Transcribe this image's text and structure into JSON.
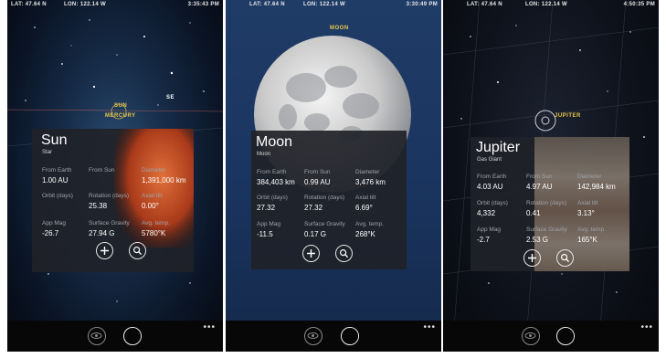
{
  "screens": [
    {
      "status": {
        "lat": "LAT: 47.64 N",
        "lon": "LON: 122.14 W",
        "time": "3:35:43 PM"
      },
      "sky_labels": {
        "sun": "SUN",
        "mercury": "MERCURY",
        "se": "SE"
      },
      "card": {
        "name": "Sun",
        "type": "Star",
        "from_earth_label": "From Earth",
        "from_earth": "1.00 AU",
        "from_sun_label": "From Sun",
        "from_sun": "",
        "diameter_label": "Diameter",
        "diameter": "1,391,000 km",
        "orbit_label": "Orbit (days)",
        "orbit": "",
        "rotation_label": "Rotation (days)",
        "rotation": "25.38",
        "axial_label": "Axial tilt",
        "axial": "0.00°",
        "appmag_label": "App Mag",
        "appmag": "-26.7",
        "gravity_label": "Surface Gravity",
        "gravity": "27.94 G",
        "temp_label": "Avg. temp.",
        "temp": "5780°K"
      }
    },
    {
      "status": {
        "lat": "LAT: 47.64 N",
        "lon": "LON: 122.14 W",
        "time": "3:30:49 PM"
      },
      "sky_labels": {
        "moon": "MOON"
      },
      "card": {
        "name": "Moon",
        "type": "Moon",
        "from_earth_label": "From Earth",
        "from_earth": "384,403 km",
        "from_sun_label": "From Sun",
        "from_sun": "0.99 AU",
        "diameter_label": "Diameter",
        "diameter": "3,476 km",
        "orbit_label": "Orbit (days)",
        "orbit": "27.32",
        "rotation_label": "Rotation (days)",
        "rotation": "27.32",
        "axial_label": "Axial tilt",
        "axial": "6.69°",
        "appmag_label": "App Mag",
        "appmag": "-11.5",
        "gravity_label": "Surface Gravity",
        "gravity": "0.17 G",
        "temp_label": "Avg. temp.",
        "temp": "268°K"
      }
    },
    {
      "status": {
        "lat": "LAT: 47.64 N",
        "lon": "LON: 122.14 W",
        "time": "4:50:35 PM"
      },
      "sky_labels": {
        "jupiter": "JUPITER"
      },
      "card": {
        "name": "Jupiter",
        "type": "Gas Giant",
        "from_earth_label": "From Earth",
        "from_earth": "4.03 AU",
        "from_sun_label": "From Sun",
        "from_sun": "4.97 AU",
        "diameter_label": "Diameter",
        "diameter": "142,984 km",
        "orbit_label": "Orbit (days)",
        "orbit": "4,332",
        "rotation_label": "Rotation (days)",
        "rotation": "0.41",
        "axial_label": "Axial tilt",
        "axial": "3.13°",
        "appmag_label": "App Mag",
        "appmag": "-2.7",
        "gravity_label": "Surface Gravity",
        "gravity": "2.53 G",
        "temp_label": "Avg. temp.",
        "temp": "165°K"
      }
    }
  ],
  "appbar": {
    "more": "•••"
  },
  "icons": {
    "add": "plus-circle-icon",
    "zoom": "zoom-icon",
    "eye": "eye-icon",
    "moon": "moon-icon"
  },
  "colors": {
    "label_yellow": "#e8c84a",
    "card_bg": "#202228",
    "appbar_bg": "#070707"
  }
}
